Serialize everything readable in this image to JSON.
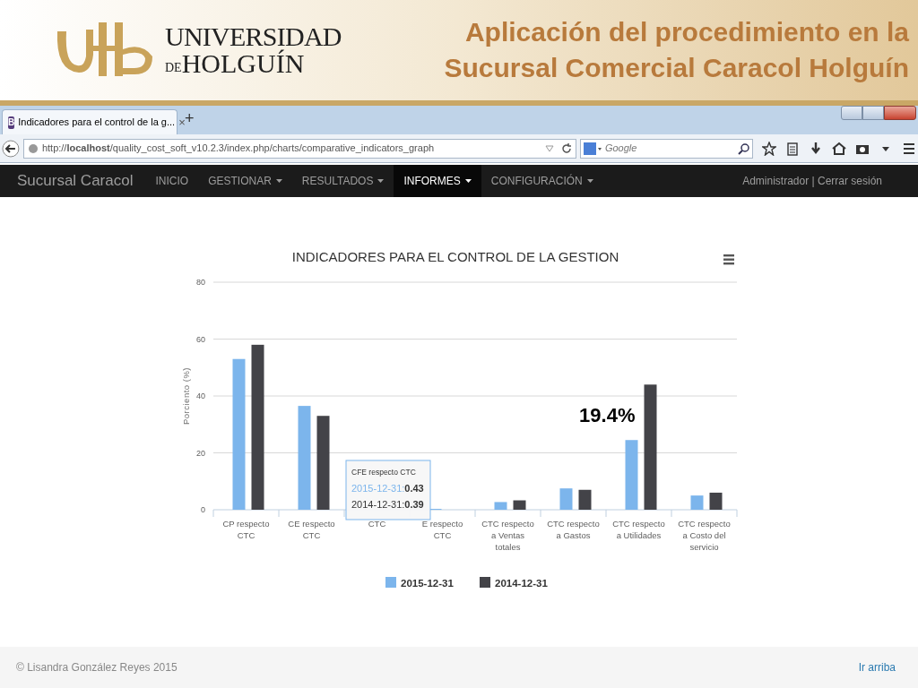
{
  "slide": {
    "logo": {
      "line1": "UNIVERSIDAD",
      "line2_prefix": "DE",
      "line2": "HOLGUÍN"
    },
    "title_lines": [
      "Aplicación del procedimiento en la",
      "Sucursal Comercial Caracol Holguín"
    ]
  },
  "browser": {
    "tab": {
      "icon_letter": "B",
      "title": "Indicadores para el control de la g...",
      "close": "×"
    },
    "new_tab": "+",
    "url": "http://**localhost**/quality_cost_soft_v10.2.3/index.php/charts/comparative_indicators_graph",
    "search_placeholder": "Google"
  },
  "navbar": {
    "brand": "Sucursal Caracol",
    "items": [
      {
        "label": "INICIO",
        "dropdown": false,
        "selected": false
      },
      {
        "label": "GESTIONAR",
        "dropdown": true,
        "selected": false
      },
      {
        "label": "RESULTADOS",
        "dropdown": true,
        "selected": false
      },
      {
        "label": "INFORMES",
        "dropdown": true,
        "selected": true
      },
      {
        "label": "CONFIGURACIÓN",
        "dropdown": true,
        "selected": false
      }
    ],
    "user": "Administrador | Cerrar sesión"
  },
  "chart": {
    "chart_data": {
      "type": "bar",
      "title": "INDICADORES PARA EL CONTROL DE LA GESTION",
      "ylabel": "Porciento (%)",
      "categories": [
        "CP respecto CTC",
        "CE respecto CTC",
        "CTC",
        "E respecto CTC",
        "CTC respecto a Ventas totales",
        "CTC respecto a Gastos",
        "CTC respecto a Utilidades",
        "CTC respecto a Costo del servicio"
      ],
      "series": [
        {
          "name": "2015-12-31",
          "color": "#7cb5ec",
          "values": [
            53,
            36.5,
            null,
            0.3,
            2.7,
            7.5,
            24.5,
            5
          ]
        },
        {
          "name": "2014-12-31",
          "color": "#434348",
          "values": [
            58,
            33,
            null,
            null,
            3.3,
            7,
            44,
            6
          ]
        }
      ],
      "ylim": [
        0,
        80
      ],
      "yticks": [
        0,
        20,
        40,
        60,
        80
      ],
      "grid": true,
      "legend": true,
      "annotations": [
        {
          "text": "19.4%"
        }
      ]
    },
    "tooltip": {
      "title": "CFE respecto CTC",
      "items": [
        {
          "label": "2015-12-31:",
          "value": "0.43"
        },
        {
          "label": "2014-12-31:",
          "value": "0.39"
        }
      ]
    }
  },
  "footer": {
    "copyright": "© Lisandra González Reyes 2015",
    "link": "Ir arriba"
  }
}
